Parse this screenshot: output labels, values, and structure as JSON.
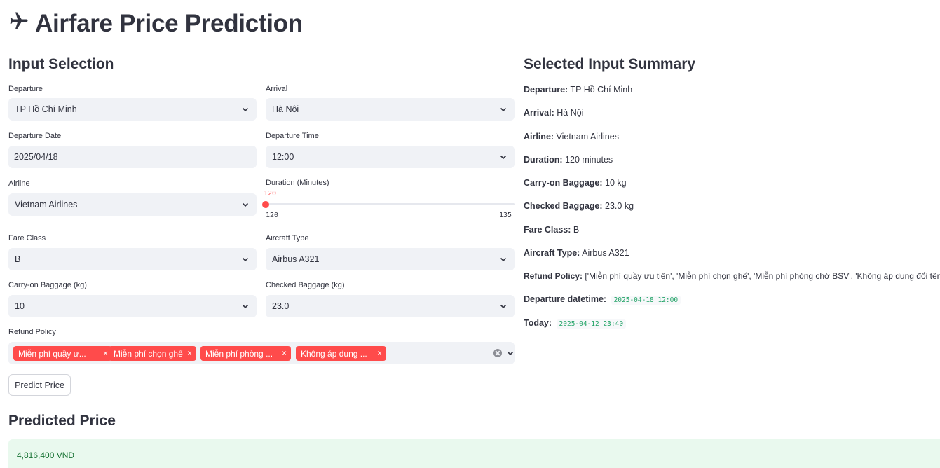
{
  "page": {
    "title": "Airfare Price Prediction",
    "title_icon": "airplane-icon"
  },
  "input_section": {
    "heading": "Input Selection",
    "departure": {
      "label": "Departure",
      "value": "TP Hồ Chí Minh"
    },
    "arrival": {
      "label": "Arrival",
      "value": "Hà Nội"
    },
    "departure_date": {
      "label": "Departure Date",
      "value": "2025/04/18"
    },
    "departure_time": {
      "label": "Departure Time",
      "value": "12:00"
    },
    "airline": {
      "label": "Airline",
      "value": "Vietnam Airlines"
    },
    "duration": {
      "label": "Duration (Minutes)",
      "value": "120",
      "min": "120",
      "max": "135"
    },
    "fare_class": {
      "label": "Fare Class",
      "value": "B"
    },
    "aircraft_type": {
      "label": "Aircraft Type",
      "value": "Airbus A321"
    },
    "carry_on": {
      "label": "Carry-on Baggage (kg)",
      "value": "10"
    },
    "checked": {
      "label": "Checked Baggage (kg)",
      "value": "23.0"
    },
    "refund_policy": {
      "label": "Refund Policy",
      "tags": [
        "Miễn phí quầy ư...",
        "Miễn phí chọn ghế",
        "Miễn phí phòng ...",
        "Không áp dụng ..."
      ]
    },
    "predict_button": "Predict Price"
  },
  "summary": {
    "heading": "Selected Input Summary",
    "rows": [
      {
        "key": "Departure:",
        "value": "TP Hồ Chí Minh"
      },
      {
        "key": "Arrival:",
        "value": "Hà Nội"
      },
      {
        "key": "Airline:",
        "value": "Vietnam Airlines"
      },
      {
        "key": "Duration:",
        "value": "120 minutes"
      },
      {
        "key": "Carry-on Baggage:",
        "value": "10 kg"
      },
      {
        "key": "Checked Baggage:",
        "value": "23.0 kg"
      },
      {
        "key": "Fare Class:",
        "value": "B"
      },
      {
        "key": "Aircraft Type:",
        "value": "Airbus A321"
      },
      {
        "key": "Refund Policy:",
        "value": "['Miễn phí quầy ưu tiên', 'Miễn phí chọn ghế', 'Miễn phí phòng chờ BSV', 'Không áp dụng đổi tên']"
      },
      {
        "key": "Departure datetime:",
        "value": "2025-04-18 12:00"
      },
      {
        "key": "Today:",
        "value": "2025-04-12 23:40"
      }
    ]
  },
  "result": {
    "heading": "Predicted Price",
    "value": "4,816,400 VND"
  },
  "colors": {
    "accent": "#ff4b4b",
    "success_bg": "#e9f9ee",
    "success_text": "#177233",
    "input_bg": "#f0f2f6"
  }
}
